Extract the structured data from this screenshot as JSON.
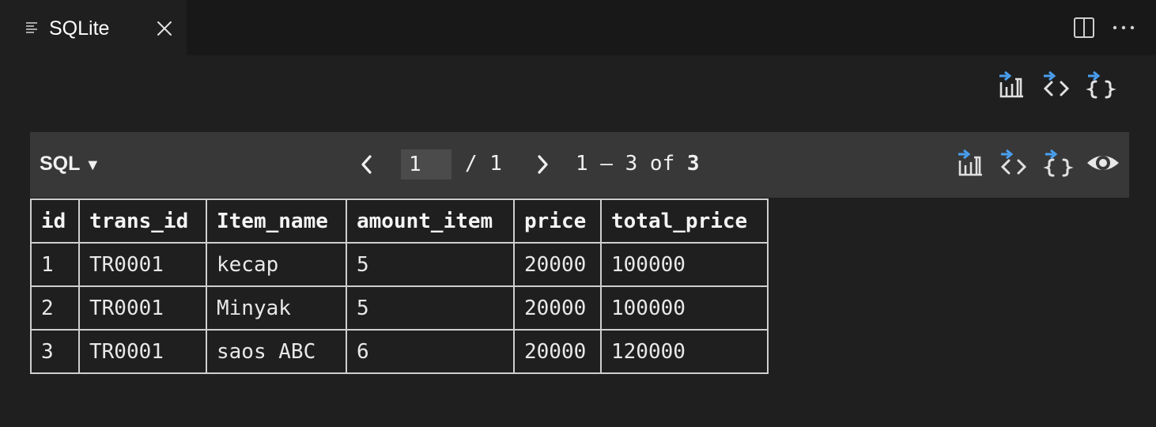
{
  "tab": {
    "title": "SQLite",
    "icon": "preview-lines-icon",
    "close_icon": "close-icon"
  },
  "editor_actions": {
    "split_icon": "split-editor-icon",
    "more_icon": "more-actions-icon"
  },
  "top_actions": [
    {
      "icon": "export-csv-icon"
    },
    {
      "icon": "export-html-icon"
    },
    {
      "icon": "export-json-icon"
    }
  ],
  "panel": {
    "sql_label": "SQL",
    "pager": {
      "current_page": "1",
      "total_pages": "/ 1",
      "range_text": "1 – 3 of",
      "total_rows": "3"
    },
    "actions": [
      {
        "icon": "export-csv-icon"
      },
      {
        "icon": "export-html-icon"
      },
      {
        "icon": "export-json-icon"
      },
      {
        "icon": "eye-icon"
      }
    ]
  },
  "table": {
    "columns": [
      "id",
      "trans_id",
      "Item_name",
      "amount_item",
      "price",
      "total_price"
    ],
    "rows": [
      [
        "1",
        "TR0001",
        "kecap",
        "5",
        "20000",
        "100000"
      ],
      [
        "2",
        "TR0001",
        "Minyak",
        "5",
        "20000",
        "100000"
      ],
      [
        "3",
        "TR0001",
        "saos ABC",
        "6",
        "20000",
        "120000"
      ]
    ]
  },
  "colors": {
    "background": "#1f1f1f",
    "tabbar": "#181818",
    "panel_bar": "#383838",
    "accent_blue": "#4a9ff0"
  }
}
